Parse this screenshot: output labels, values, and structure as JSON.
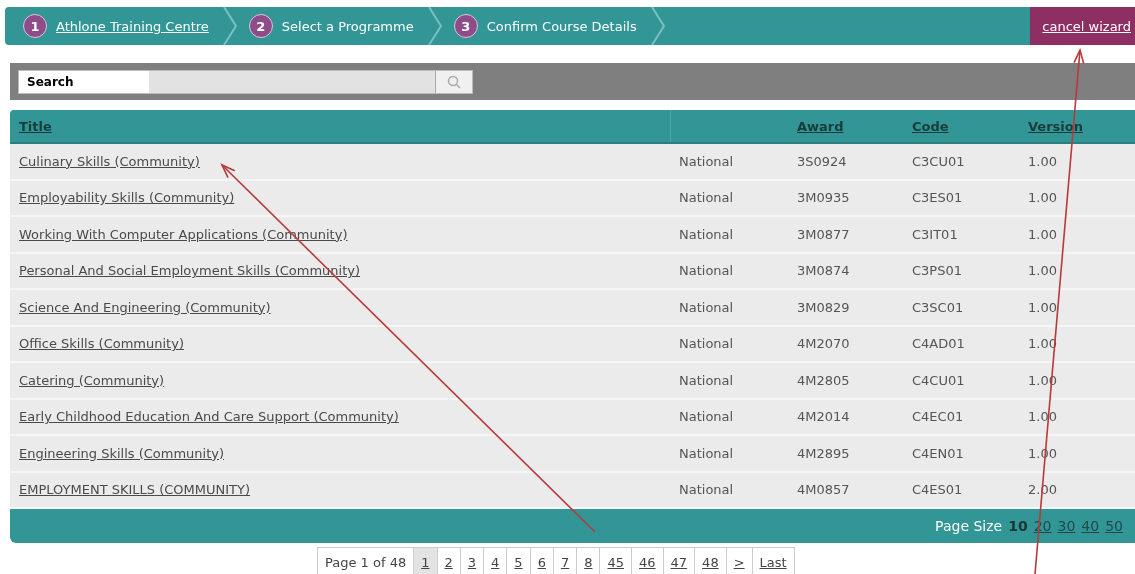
{
  "wizard": {
    "steps": [
      {
        "number": "1",
        "label": "Athlone Training Centre",
        "link": true
      },
      {
        "number": "2",
        "label": "Select a Programme",
        "link": false
      },
      {
        "number": "3",
        "label": "Confirm Course Details",
        "link": false
      }
    ],
    "cancel": "cancel wizard"
  },
  "search": {
    "label": "Search"
  },
  "table": {
    "columns": {
      "title": "Title",
      "award": "Award",
      "code": "Code",
      "version": "Version"
    },
    "rows": [
      {
        "title": "Culinary Skills (Community)",
        "column_2": "National",
        "award": "3S0924",
        "code": "C3CU01",
        "version": "1.00"
      },
      {
        "title": "Employability Skills (Community)",
        "column_2": "National",
        "award": "3M0935",
        "code": "C3ES01",
        "version": "1.00"
      },
      {
        "title": "Working With Computer Applications (Community)",
        "column_2": "National",
        "award": "3M0877",
        "code": "C3IT01",
        "version": "1.00"
      },
      {
        "title": "Personal And Social Employment Skills (Community)",
        "column_2": "National",
        "award": "3M0874",
        "code": "C3PS01",
        "version": "1.00"
      },
      {
        "title": "Science And Engineering (Community)",
        "column_2": "National",
        "award": "3M0829",
        "code": "C3SC01",
        "version": "1.00"
      },
      {
        "title": "Office Skills (Community)",
        "column_2": "National",
        "award": "4M2070",
        "code": "C4AD01",
        "version": "1.00"
      },
      {
        "title": "Catering (Community)",
        "column_2": "National",
        "award": "4M2805",
        "code": "C4CU01",
        "version": "1.00"
      },
      {
        "title": "Early Childhood Education And Care Support (Community)",
        "column_2": "National",
        "award": "4M2014",
        "code": "C4EC01",
        "version": "1.00"
      },
      {
        "title": "Engineering Skills (Community)",
        "column_2": "National",
        "award": "4M2895",
        "code": "C4EN01",
        "version": "1.00"
      },
      {
        "title": "EMPLOYMENT SKILLS (COMMUNITY)",
        "column_2": "National",
        "award": "4M0857",
        "code": "C4ES01",
        "version": "2.00"
      }
    ],
    "page_size": {
      "label": "Page Size",
      "sizes": [
        {
          "label": "10",
          "selected": true
        },
        {
          "label": "20",
          "selected": false
        },
        {
          "label": "30",
          "selected": false
        },
        {
          "label": "40",
          "selected": false
        },
        {
          "label": "50",
          "selected": false
        }
      ]
    }
  },
  "pager": {
    "info": "Page 1 of 48",
    "pages": [
      {
        "label": "1",
        "selected": true
      },
      {
        "label": "2",
        "selected": false
      },
      {
        "label": "3",
        "selected": false
      },
      {
        "label": "4",
        "selected": false
      },
      {
        "label": "5",
        "selected": false
      },
      {
        "label": "6",
        "selected": false
      },
      {
        "label": "7",
        "selected": false
      },
      {
        "label": "8",
        "selected": false
      },
      {
        "label": "45",
        "selected": false
      },
      {
        "label": "46",
        "selected": false
      },
      {
        "label": "47",
        "selected": false
      },
      {
        "label": "48",
        "selected": false
      }
    ],
    "next": ">",
    "last": "Last"
  }
}
